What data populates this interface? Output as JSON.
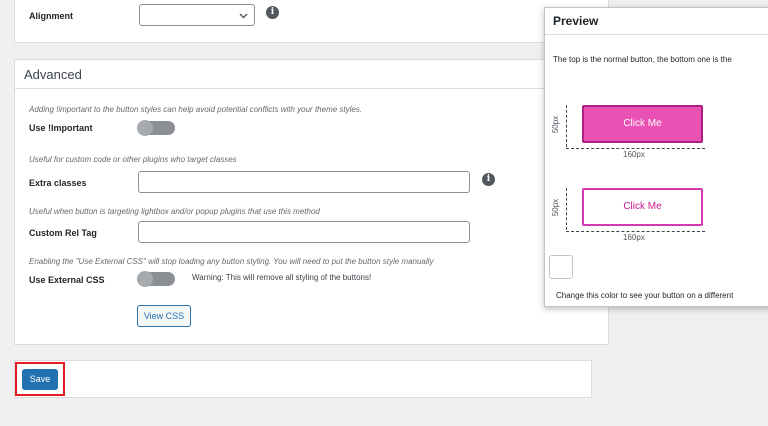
{
  "alignment": {
    "label": "Alignment",
    "select_value": "",
    "chevron": "chevron-down-icon",
    "info": "i"
  },
  "advanced": {
    "title": "Advanced",
    "important_hint": "Adding !important to the button styles can help avoid potential conflicts with your theme styles.",
    "important_label": "Use !Important",
    "extra_hint": "Useful for custom code or other plugins who target classes",
    "extra_label": "Extra classes",
    "extra_value": "",
    "info": "i",
    "rel_hint": "Useful when button is targeting lightbox and/or popup plugins that use this method",
    "rel_label": "Custom Rel Tag",
    "rel_value": "",
    "external_hint": "Enabling the \"Use External CSS\" will stop loading any button styling. You will need to put the button style manually",
    "external_label": "Use External CSS",
    "external_warning": "Warning: This will remove all styling of the buttons!",
    "view_css": "View CSS"
  },
  "footer": {
    "save": "Save",
    "highlight_color": "#e31b23"
  },
  "preview": {
    "title": "Preview",
    "description": "The top is the normal button, the bottom one is the",
    "button_text": "Click Me",
    "height_label": "50px",
    "width_label": "160px",
    "color_hint": "Change this color to see your button on a different",
    "colors": {
      "normal_bg": "#e952b4",
      "normal_border": "#b01d83",
      "hover_border": "#d639b3",
      "hover_text": "#c6168d"
    }
  }
}
